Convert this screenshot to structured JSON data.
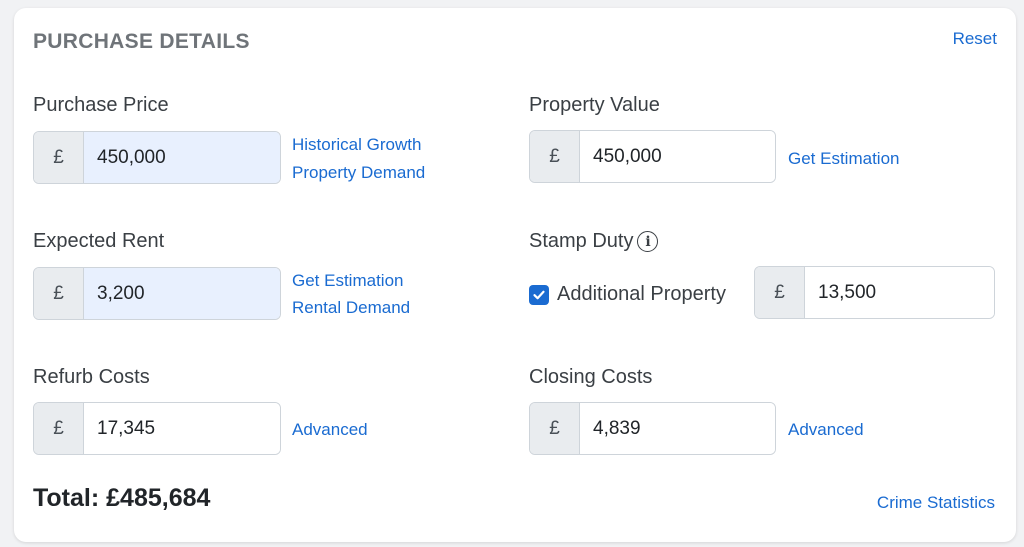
{
  "section": {
    "title": "PURCHASE DETAILS",
    "reset_label": "Reset"
  },
  "currency_symbol": "£",
  "purchase_price": {
    "label": "Purchase Price",
    "value": "450,000",
    "links": [
      "Historical Growth",
      "Property Demand"
    ]
  },
  "property_value": {
    "label": "Property Value",
    "value": "450,000",
    "link": "Get Estimation"
  },
  "expected_rent": {
    "label": "Expected Rent",
    "value": "3,200",
    "links": [
      "Get Estimation",
      "Rental Demand"
    ]
  },
  "stamp_duty": {
    "label": "Stamp Duty",
    "info_icon": "info-circle-icon",
    "checkbox_label": "Additional Property",
    "checked": true,
    "value": "13,500"
  },
  "refurb_costs": {
    "label": "Refurb Costs",
    "value": "17,345",
    "link": "Advanced"
  },
  "closing_costs": {
    "label": "Closing Costs",
    "value": "4,839",
    "link": "Advanced"
  },
  "total": {
    "text": "Total: £485,684"
  },
  "crime_statistics_label": "Crime Statistics",
  "colors": {
    "link": "#1a6bd1",
    "autofill_bg": "#e8f0fe",
    "prefix_bg": "#e9ecef"
  }
}
